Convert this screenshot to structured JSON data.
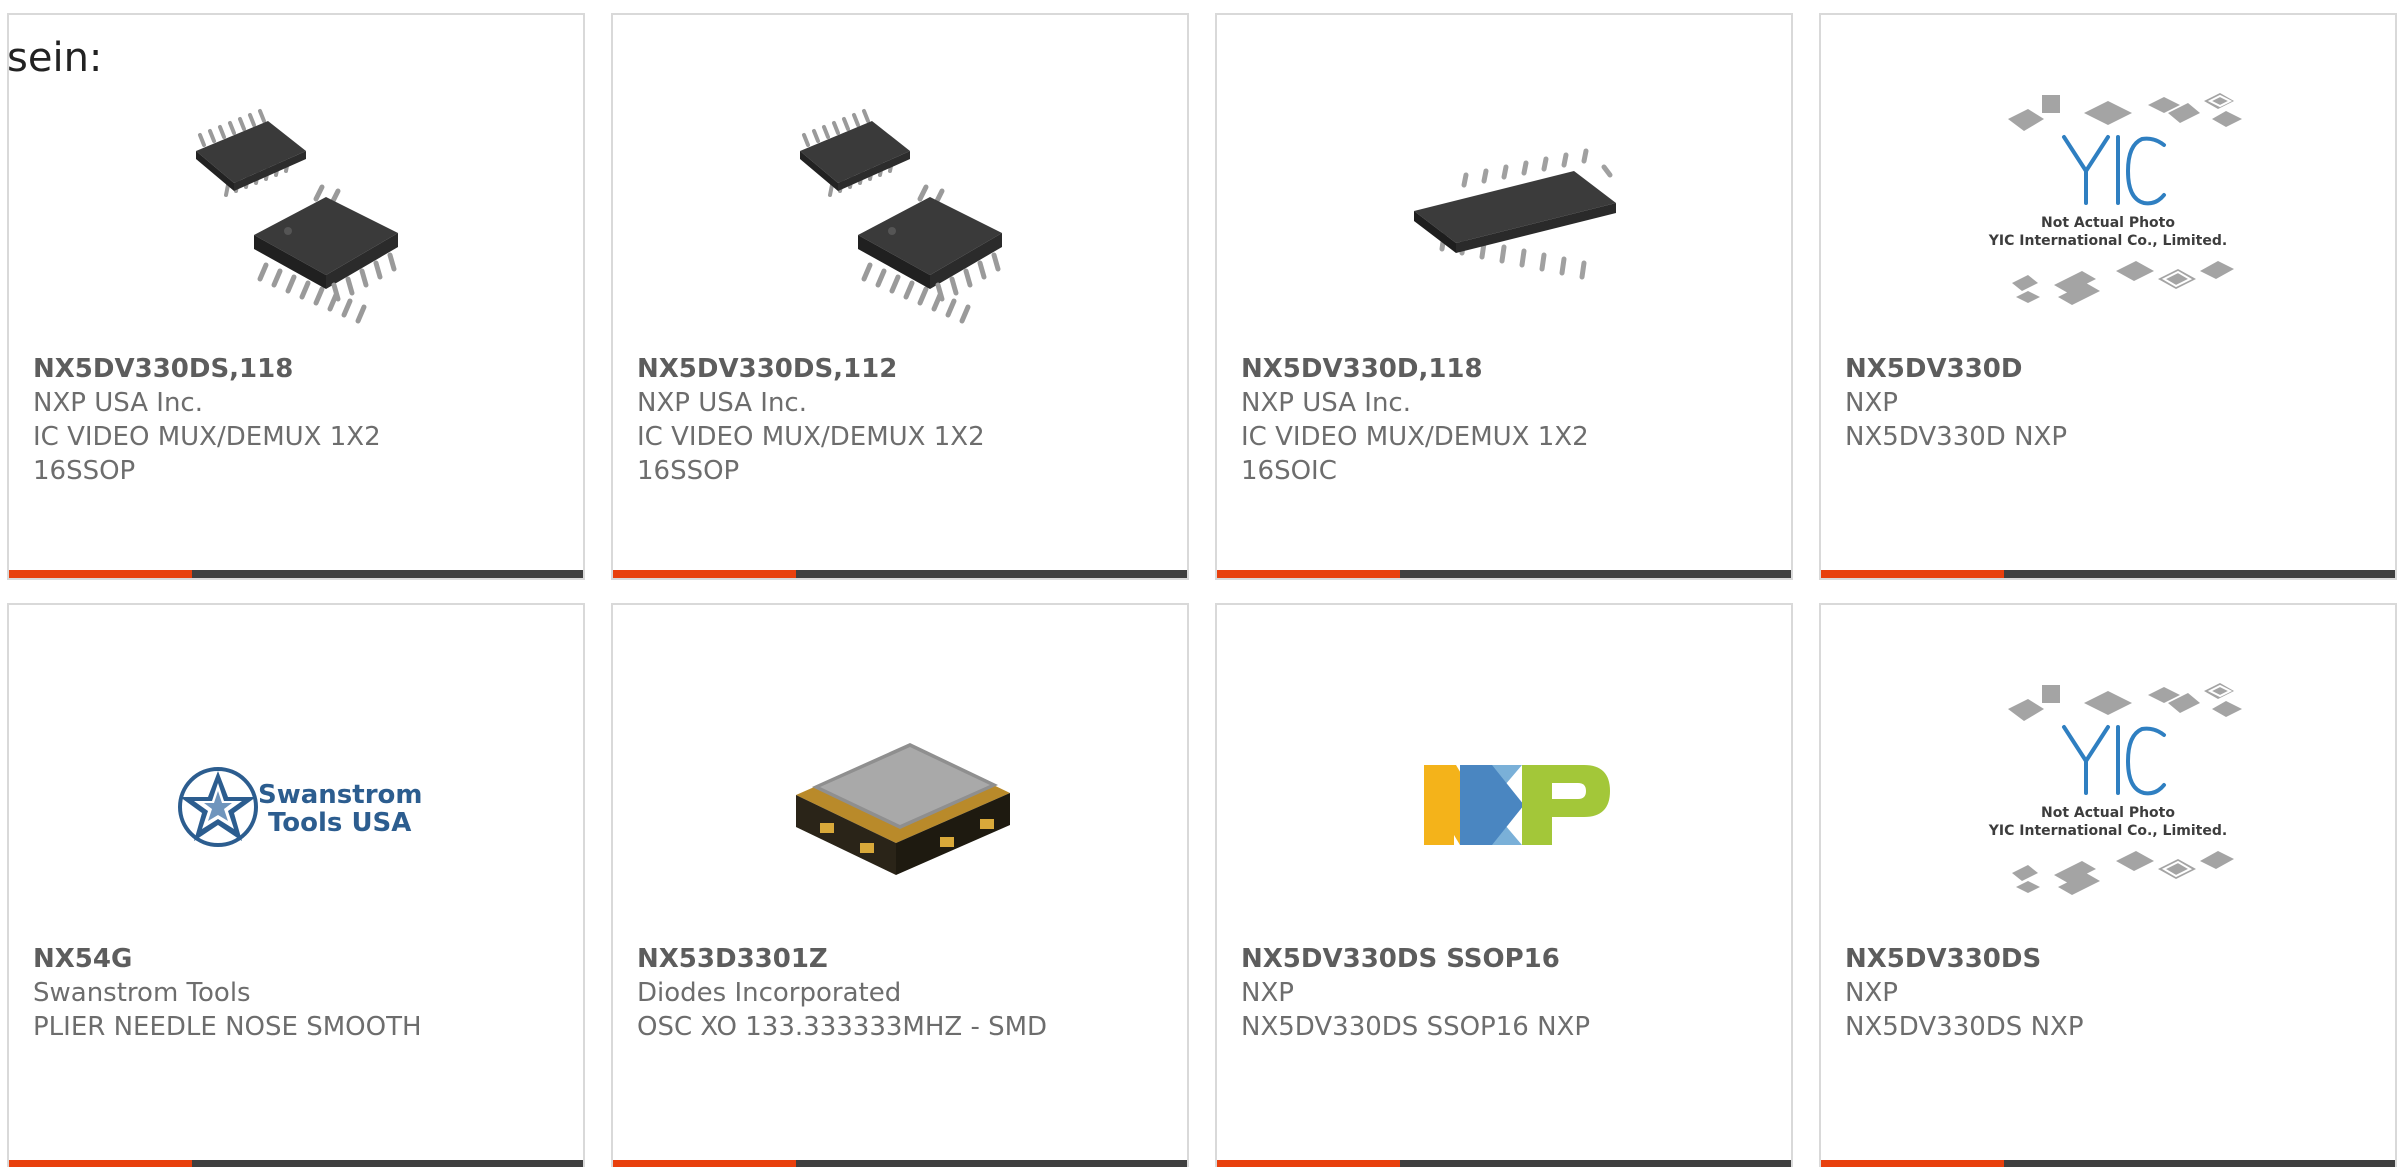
{
  "intro_text": "sein:",
  "colors": {
    "accent": "#e8400d",
    "bar_dark": "#3f3f3f",
    "card_border": "#d9d9d9",
    "text": "#6d6d6d"
  },
  "products": [
    {
      "part_number": "NX5DV330DS,118",
      "manufacturer": "NXP USA Inc.",
      "desc_line1": "IC VIDEO MUX/DEMUX 1X2",
      "desc_line2": "16SSOP",
      "image": "ssop-chip-pair-image"
    },
    {
      "part_number": "NX5DV330DS,112",
      "manufacturer": "NXP USA Inc.",
      "desc_line1": "IC VIDEO MUX/DEMUX 1X2",
      "desc_line2": "16SSOP",
      "image": "ssop-chip-pair-image"
    },
    {
      "part_number": "NX5DV330D,118",
      "manufacturer": "NXP USA Inc.",
      "desc_line1": "IC VIDEO MUX/DEMUX 1X2",
      "desc_line2": "16SOIC",
      "image": "soic-chip-image"
    },
    {
      "part_number": "NX5DV330D",
      "manufacturer": "NXP",
      "desc_line1": "NX5DV330D NXP",
      "desc_line2": "",
      "image": "yic-placeholder-image",
      "placeholder_line1": "Not Actual Photo",
      "placeholder_line2": "YIC International Co., Limited."
    },
    {
      "part_number": "NX54G",
      "manufacturer": "Swanstrom Tools",
      "desc_line1": "PLIER NEEDLE NOSE SMOOTH",
      "desc_line2": "",
      "image": "swanstrom-logo-image",
      "logo_line1": "Swanstrom",
      "logo_line2": "Tools USA"
    },
    {
      "part_number": "NX53D3301Z",
      "manufacturer": "Diodes Incorporated",
      "desc_line1": "OSC XO 133.333333MHZ - SMD",
      "desc_line2": "",
      "image": "oscillator-image"
    },
    {
      "part_number": "NX5DV330DS SSOP16",
      "manufacturer": "NXP",
      "desc_line1": "NX5DV330DS SSOP16 NXP",
      "desc_line2": "",
      "image": "nxp-logo-image"
    },
    {
      "part_number": "NX5DV330DS",
      "manufacturer": "NXP",
      "desc_line1": "NX5DV330DS NXP",
      "desc_line2": "",
      "image": "yic-placeholder-image",
      "placeholder_line1": "Not Actual Photo",
      "placeholder_line2": "YIC International Co., Limited."
    }
  ]
}
